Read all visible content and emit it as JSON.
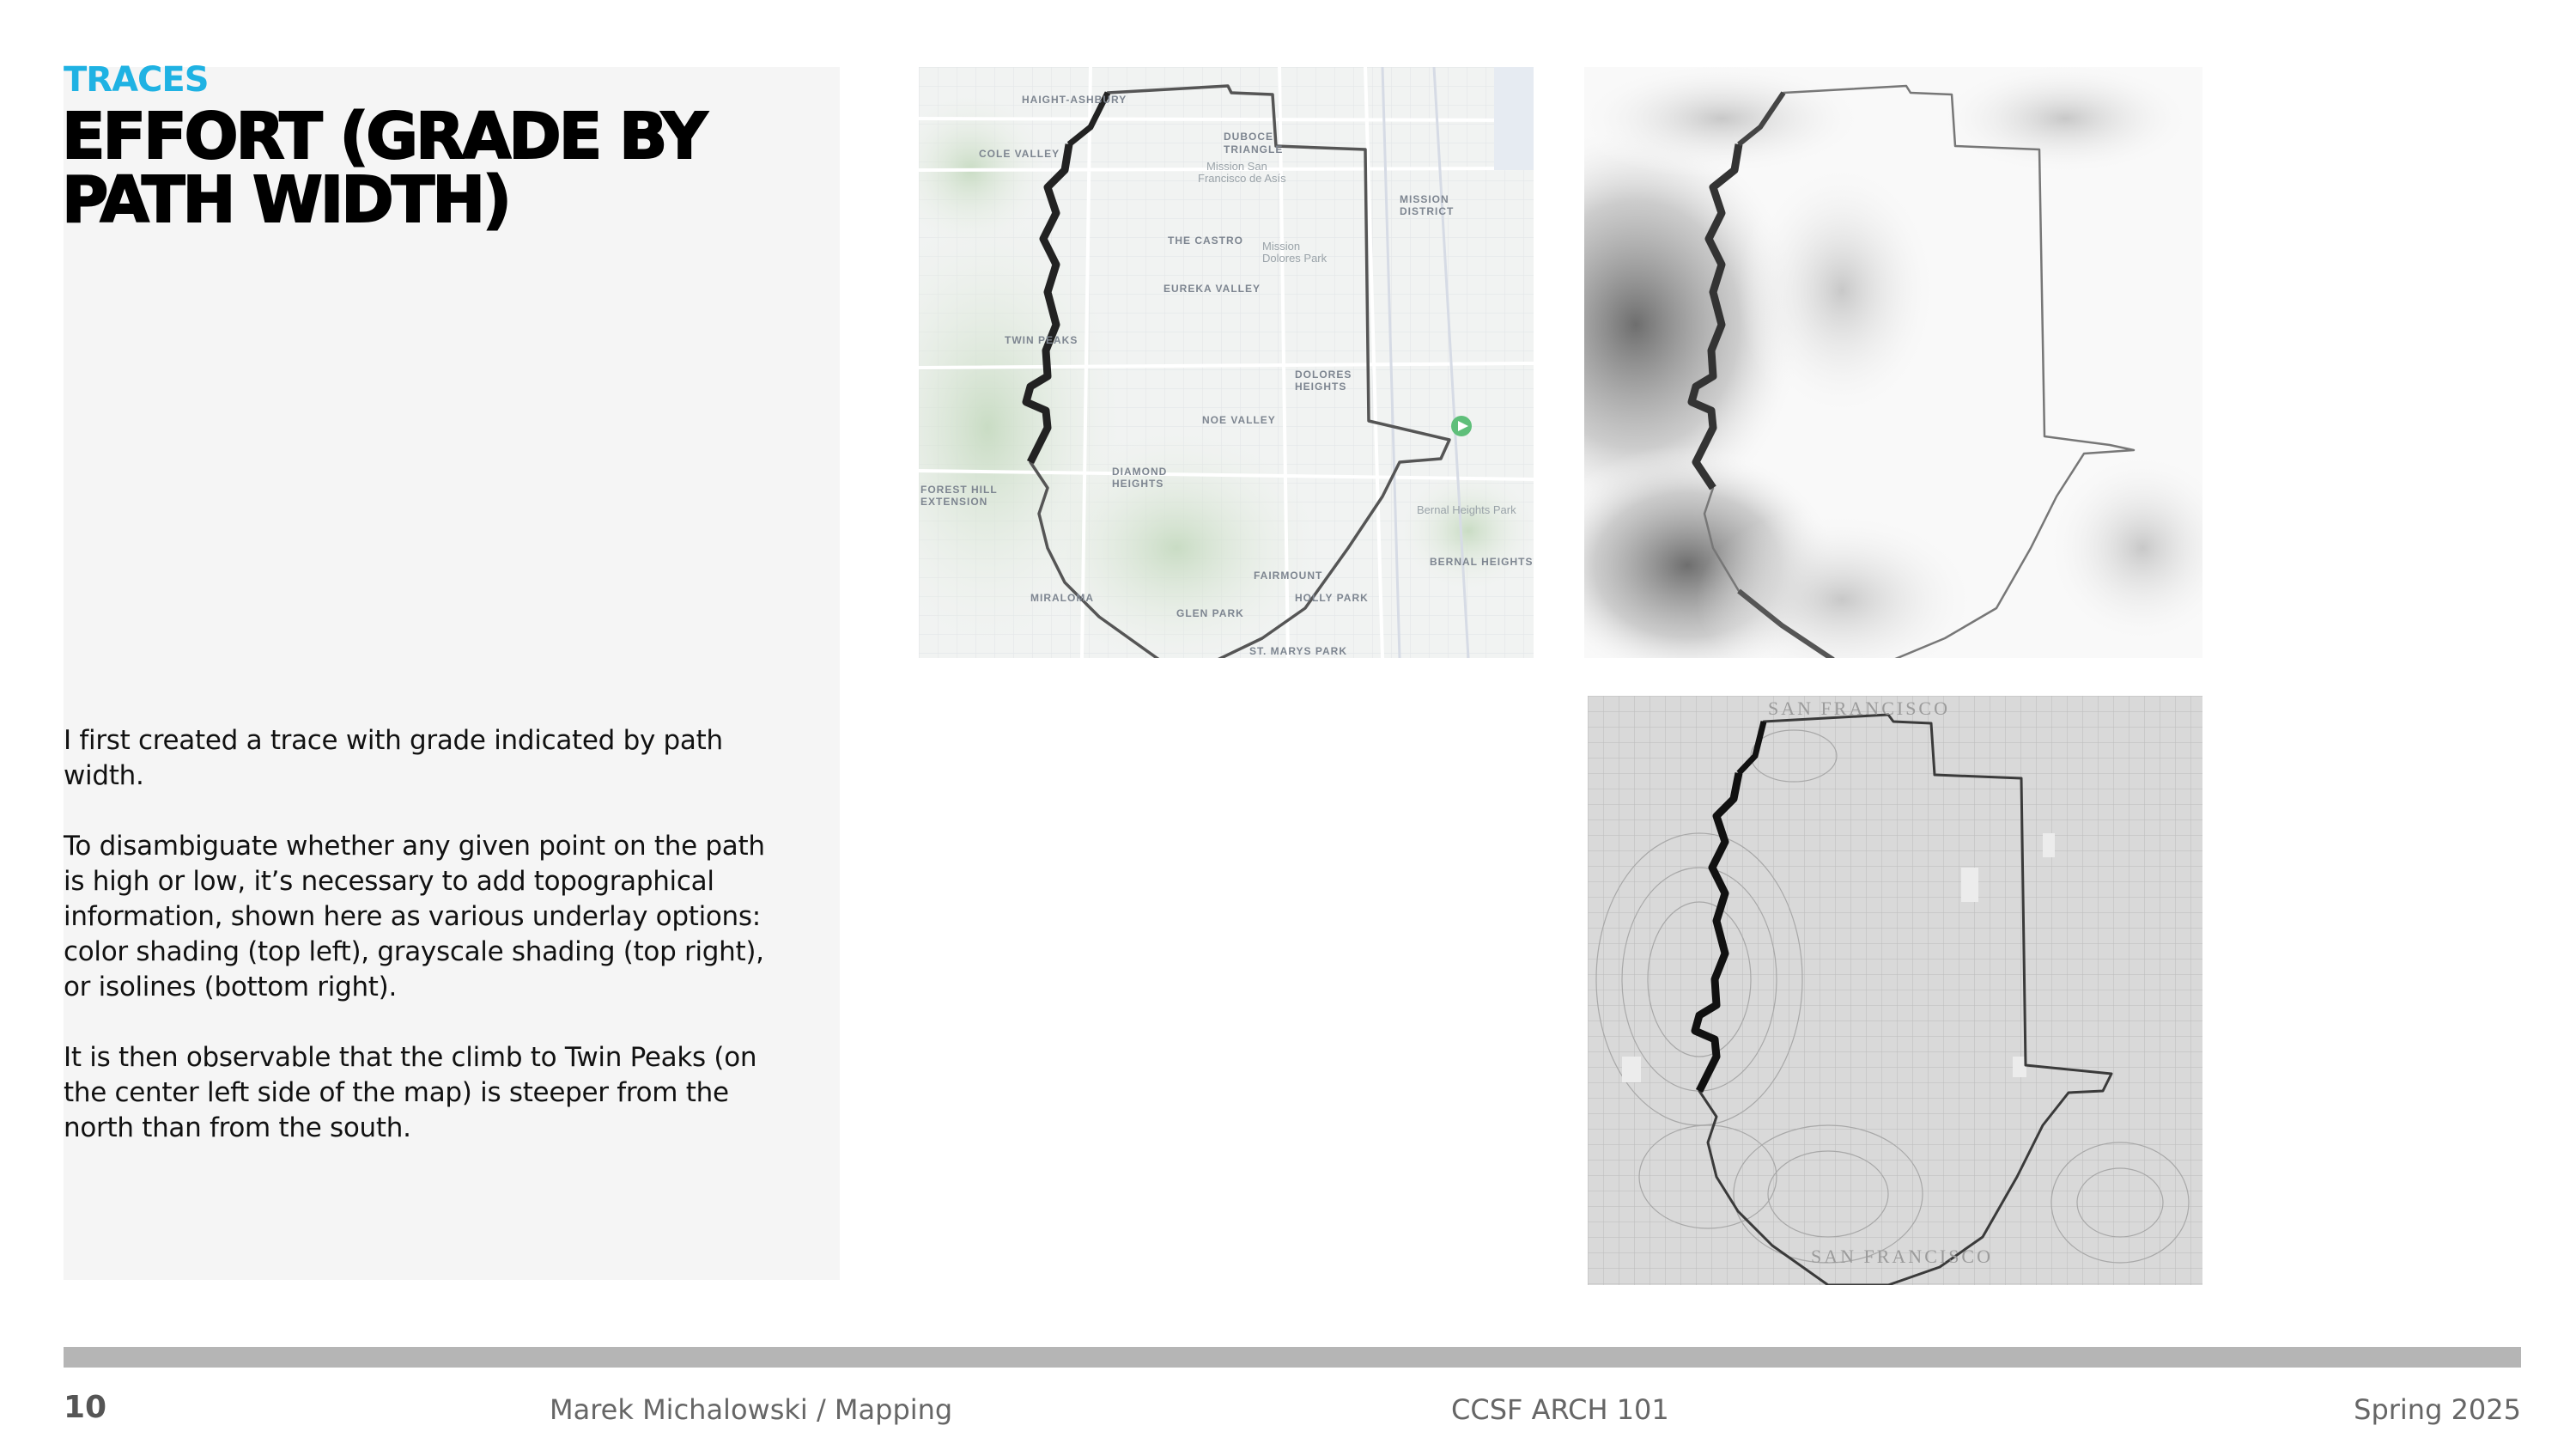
{
  "slide": {
    "kicker": "TRACES",
    "title": "EFFORT (GRADE BY PATH WIDTH)",
    "paragraphs": [
      "I first created a trace with grade indicated by path width.",
      "To disambiguate whether any given point on the path is high or low, it’s necessary to add topographical information, shown here as various underlay options: color shading (top left), grayscale shading (top right), or isolines (bottom right).",
      "It is then observable that the climb to Twin Peaks (on the center left side of the map) is steeper from the north than from the south."
    ]
  },
  "maps": {
    "color_labels": [
      "HAIGHT-ASHBURY",
      "COLE VALLEY",
      "DUBOCE TRIANGLE",
      "Mission San Francisco de Asís",
      "MISSION DISTRICT",
      "THE CASTRO",
      "Mission Dolores Park",
      "EUREKA VALLEY",
      "TWIN PEAKS",
      "DOLORES HEIGHTS",
      "NOE VALLEY",
      "DIAMOND HEIGHTS",
      "FOREST HILL EXTENSION",
      "FAIRMOUNT",
      "HOLLY PARK",
      "GLEN PARK",
      "MIRALOMA",
      "BERNAL HEIGHTS",
      "Bernal Heights Park",
      "ST. MARYS PARK"
    ],
    "iso_labels": [
      "SAN FRANCISCO",
      "SAN FRANCISCO"
    ]
  },
  "footer": {
    "page_number": "10",
    "author": "Marek Michalowski / Mapping",
    "course": "CCSF ARCH 101",
    "term": "Spring 2025"
  },
  "colors": {
    "accent": "#1fb2e3",
    "panel": "#f5f5f5",
    "rule": "#b5b5b5"
  }
}
